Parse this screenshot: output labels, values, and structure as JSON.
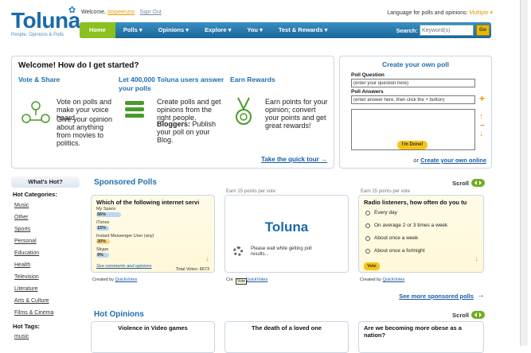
{
  "header": {
    "logo": "Toluna",
    "tagline": "People, Opinions & Polls",
    "welcome_prefix": "Welcome,",
    "username": "loopeenzor",
    "signout": "Sign Out",
    "language_label": "Language for polls and opinions:",
    "language_value": "Multiple"
  },
  "nav": {
    "items": [
      "Home",
      "Polls",
      "Opinions",
      "Explore",
      "You",
      "Test & Rewards"
    ],
    "search_label": "Search:",
    "search_placeholder": "Keyword(s)",
    "go_label": "Go"
  },
  "getting_started": {
    "title": "Welcome! How do I get started?",
    "col1_h": "Vote & Share",
    "col1_t1": "Vote on polls and make your voice heard.",
    "col1_t2": "Give your opinion about anything from movies to politics.",
    "col2_h": "Let 400,000 Toluna users answer your polls",
    "col2_t1": "Create polls and get opinions from the right people.",
    "col2_t2a": "Bloggers:",
    "col2_t2b": "Publish your poll on your Blog.",
    "col3_h": "Earn Rewards",
    "col3_t": "Earn points for your opinion; convert your points and get great rewards!",
    "tour": "Take the quick tour"
  },
  "create_poll": {
    "title": "Create your own poll",
    "question_label": "Poll Question",
    "question_value": "(enter your question here)",
    "answers_label": "Poll Answers",
    "answers_value": "(enter answer here, then click the + button)",
    "done": "I'm Done!",
    "or": "or",
    "online_link": "Create your own online"
  },
  "sidebar": {
    "whats_hot": "What's Hot?",
    "categories_h": "Hot Categories:",
    "categories": [
      "Music",
      "Other",
      "Sports",
      "Personal",
      "Education",
      "Health",
      "Television",
      "Literature",
      "Arts & Culture",
      "Films & Cinema"
    ],
    "tags_h": "Hot Tags:",
    "tags": [
      "music"
    ]
  },
  "sponsored": {
    "title": "Sponsored Polls",
    "scroll": "Scroll",
    "earn_2": "Earn 15 points per vote",
    "earn_3": "Earn 15 points per vote",
    "poll1": {
      "question": "Which of the following internet servi",
      "options": [
        {
          "label": "My Space",
          "pct": "56%",
          "frac": 0.56,
          "color": "blue"
        },
        {
          "label": "iTunes",
          "pct": "15%",
          "frac": 0.15,
          "color": "blue"
        },
        {
          "label": "Instant Messenger User (any)",
          "pct": "30%",
          "frac": 0.3,
          "color": "yel"
        },
        {
          "label": "Skype",
          "pct": "9%",
          "frac": 0.09,
          "color": "blue"
        }
      ],
      "comments_link": "See comments and opinions",
      "total": "Total Votes: 8673",
      "created_by": "Created by",
      "creator": "QuickVotes"
    },
    "poll2": {
      "brand": "Toluna",
      "wait": "Please wait while getting poll results...",
      "created_by": "Cre",
      "tooltip": "Vote",
      "creator": "QuickVotes"
    },
    "poll3": {
      "question": "Radio listeners, how often do you tu",
      "options": [
        "Every day",
        "On average 2 or 3 times a week",
        "About once a week",
        "About once a fortnight"
      ],
      "vote": "Vote",
      "created_by": "Created by",
      "creator": "QuickVotes"
    },
    "see_more": "See more sponsored polls"
  },
  "hot_opinions": {
    "title": "Hot Opinions",
    "scroll": "Scroll",
    "cards": [
      "Violence in Video games",
      "The death of a loved one",
      "Are we becoming more obese as a nation?"
    ]
  },
  "colors": {
    "brand_blue": "#1b6aa8",
    "nav_green": "#8ac11f",
    "accent_orange": "#e69b00",
    "button_yellow": "#f5c518"
  }
}
